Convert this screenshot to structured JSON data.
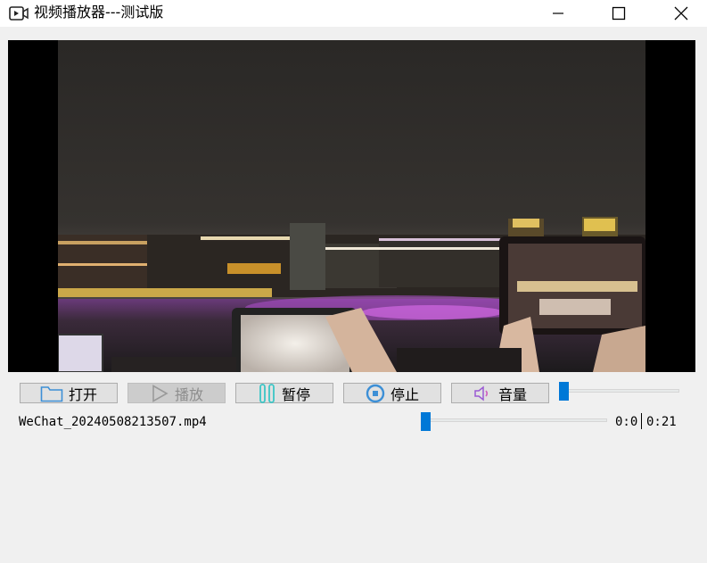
{
  "window": {
    "title": "视频播放器---测试版",
    "icon": "video-player-icon"
  },
  "controls": {
    "open_label": "打开",
    "play_label": "播放",
    "pause_label": "暂停",
    "stop_label": "停止",
    "volume_label": "音量",
    "play_enabled": false
  },
  "volume": {
    "level": 0.0
  },
  "media": {
    "filename": "WeChat_20240508213507.mp4",
    "current_time": "0:0",
    "total_time": "0:21",
    "progress": 0.02
  },
  "colors": {
    "accent": "#0078d7",
    "button_bg": "#e1e1e1",
    "window_bg": "#f0f0f0",
    "icon_blue": "#3c8fd6",
    "pause_teal": "#3cc6c6",
    "volume_purple": "#9b5ad4"
  }
}
